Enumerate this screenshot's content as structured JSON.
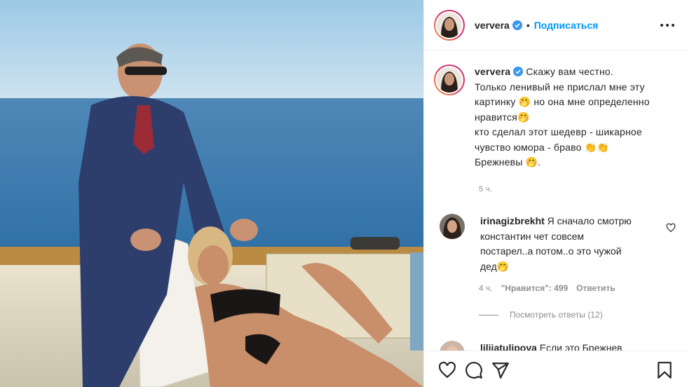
{
  "post": {
    "username": "ververa",
    "separator": "•",
    "follow_label": "Подписаться",
    "caption_lines": [
      "Скажу вам честно.",
      "Только ленивый не прислал мне эту",
      "картинку 🤭 но она мне определенно",
      "нравится🤭",
      "кто сделал этот шедевр - шикарное",
      "чувство юмора - браво 👏👏",
      "Брежневы 🤭."
    ],
    "time_ago": "5 ч."
  },
  "comments": [
    {
      "username": "irinagizbrekht",
      "text_lines": [
        " Я сначало смотрю",
        "константин чет совсем",
        "постарел..а потом..о это чужой",
        "дед🤭"
      ],
      "time_ago": "4 ч.",
      "likes_label": "\"Нравится\": 499",
      "reply_label": "Ответить",
      "view_replies": "Посмотреть ответы (12)"
    },
    {
      "username": "liliiatulipova",
      "text": " Если это Брежнев"
    }
  ],
  "colors": {
    "accent": "#0095f6",
    "muted": "#8e8e8e",
    "text": "#262626"
  },
  "icons": {
    "more": "ellipsis-icon",
    "verified": "verified-badge-icon",
    "like": "heart-icon",
    "comment": "comment-icon",
    "share": "paper-plane-icon",
    "save": "bookmark-icon"
  }
}
